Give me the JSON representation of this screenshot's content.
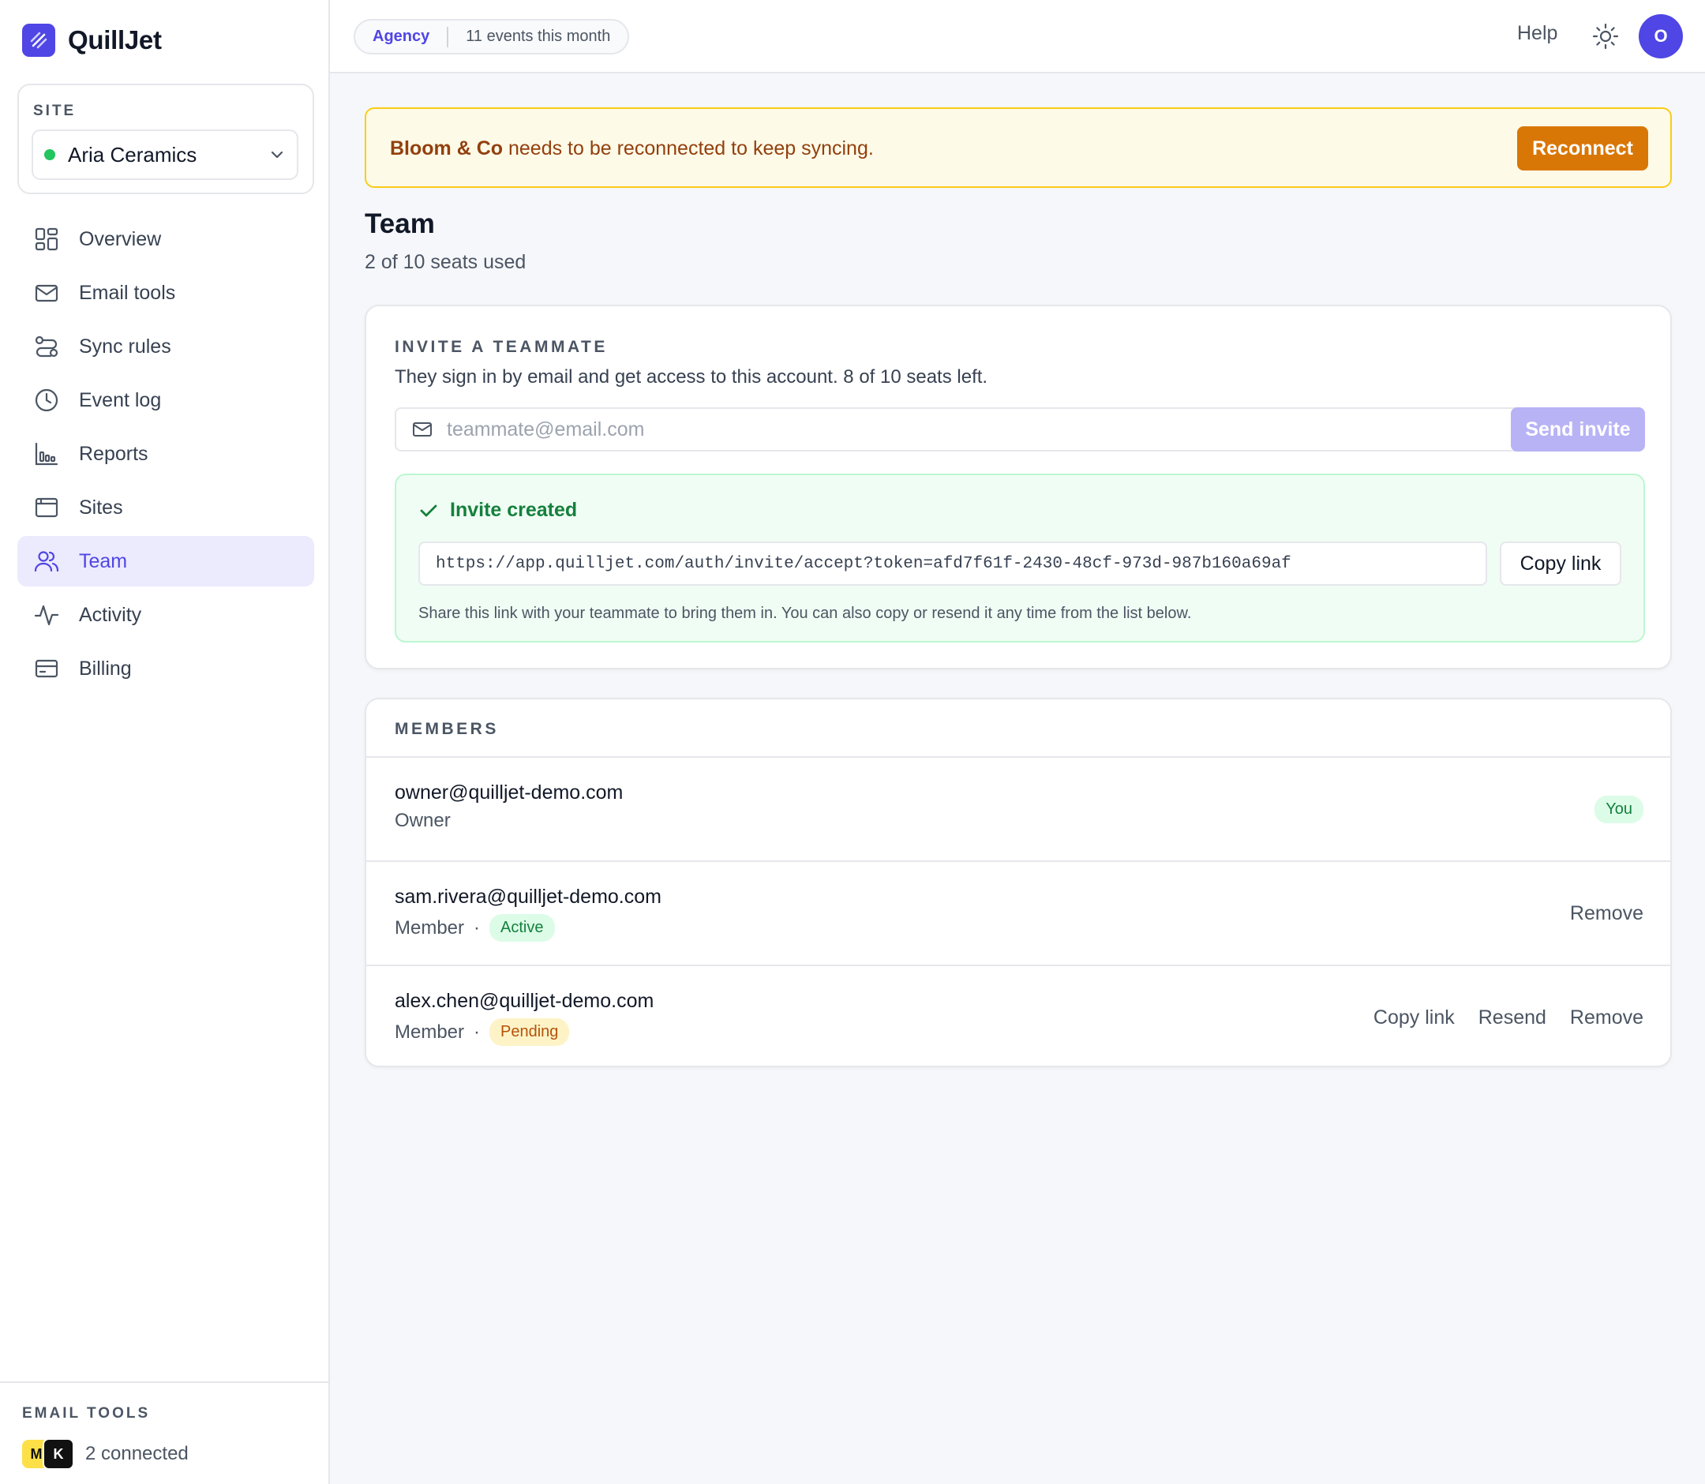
{
  "app": {
    "name": "QuillJet",
    "logo_icon": "quill-logo-icon"
  },
  "sidebar": {
    "site_label": "SITE",
    "site_name": "Aria Ceramics",
    "site_status_color": "#22c55e",
    "nav": [
      {
        "label": "Overview",
        "icon": "grid-icon"
      },
      {
        "label": "Email tools",
        "icon": "mail-icon"
      },
      {
        "label": "Sync rules",
        "icon": "route-icon"
      },
      {
        "label": "Event log",
        "icon": "clock-icon"
      },
      {
        "label": "Reports",
        "icon": "bar-chart-icon"
      },
      {
        "label": "Sites",
        "icon": "browser-window-icon"
      },
      {
        "label": "Team",
        "icon": "users-icon",
        "active": true
      },
      {
        "label": "Activity",
        "icon": "activity-pulse-icon"
      },
      {
        "label": "Billing",
        "icon": "credit-card-icon"
      }
    ],
    "footer": {
      "label": "EMAIL TOOLS",
      "tools": [
        "M",
        "K"
      ],
      "count_text": "2 connected"
    }
  },
  "topbar": {
    "plan": "Agency",
    "events": "11 events this month",
    "help": "Help",
    "theme_icon": "sun-icon",
    "avatar_initial": "O"
  },
  "alert": {
    "account": "Bloom & Co",
    "message": " needs to be reconnected to keep syncing.",
    "button": "Reconnect"
  },
  "page": {
    "title": "Team",
    "subtitle": "2 of 10 seats used"
  },
  "invite": {
    "label": "INVITE A TEAMMATE",
    "description": "They sign in by email and get access to this account. 8 of 10 seats left.",
    "email_placeholder": "teammate@email.com",
    "email_value": "",
    "send_button": "Send invite",
    "success": {
      "title": "Invite created",
      "link": "https://app.quilljet.com/auth/invite/accept?token=afd7f61f-2430-48cf-973d-987b160a69af",
      "copy_button": "Copy link",
      "note": "Share this link with your teammate to bring them in. You can also copy or resend it any time from the list below."
    }
  },
  "members": {
    "label": "MEMBERS",
    "rows": [
      {
        "email": "owner@quilljet-demo.com",
        "role": "Owner",
        "badge": "You"
      },
      {
        "email": "sam.rivera@quilljet-demo.com",
        "role": "Member",
        "status": "Active",
        "actions": [
          "Remove"
        ]
      },
      {
        "email": "alex.chen@quilljet-demo.com",
        "role": "Member",
        "status": "Pending",
        "actions": [
          "Copy link",
          "Resend",
          "Remove"
        ]
      }
    ],
    "dot": "·"
  },
  "colors": {
    "accent": "#4f46e5",
    "warning": "#d97706",
    "success": "#15803d"
  }
}
